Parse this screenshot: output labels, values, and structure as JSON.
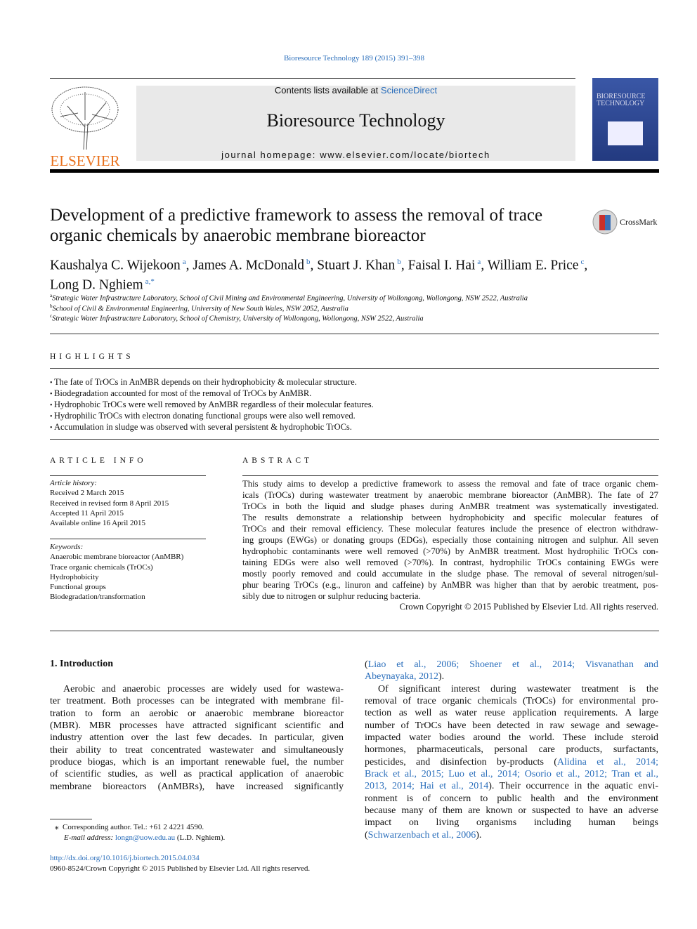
{
  "journal_ref": "Bioresource Technology 189 (2015) 391–398",
  "header": {
    "contents_prefix": "Contents lists available at ",
    "contents_link": "ScienceDirect",
    "journal_title": "Bioresource Technology",
    "homepage": "journal homepage: www.elsevier.com/locate/biortech",
    "publisher_logo": "ELSEVIER",
    "cover_text": "BIORESOURCE TECHNOLOGY"
  },
  "colors": {
    "link": "#2a6ebb",
    "elsevier_orange": "#e9711c"
  },
  "title": "Development of a predictive framework to assess the removal of trace organic chemicals by anaerobic membrane bioreactor",
  "crossmark": "CrossMark",
  "authors": [
    {
      "name": "Kaushalya C. Wijekoon",
      "sup": "a"
    },
    {
      "name": "James A. McDonald",
      "sup": "b"
    },
    {
      "name": "Stuart J. Khan",
      "sup": "b"
    },
    {
      "name": "Faisal I. Hai",
      "sup": "a"
    },
    {
      "name": "William E. Price",
      "sup": "c"
    },
    {
      "name": "Long D. Nghiem",
      "sup": "a,*"
    }
  ],
  "affiliations": [
    {
      "sup": "a",
      "text": "Strategic Water Infrastructure Laboratory, School of Civil Mining and Environmental Engineering, University of Wollongong, Wollongong, NSW 2522, Australia"
    },
    {
      "sup": "b",
      "text": "School of Civil & Environmental Engineering, University of New South Wales, NSW 2052, Australia"
    },
    {
      "sup": "c",
      "text": "Strategic Water Infrastructure Laboratory, School of Chemistry, University of Wollongong, Wollongong, NSW 2522, Australia"
    }
  ],
  "highlights": {
    "heading": "HIGHLIGHTS",
    "items": [
      "The fate of TrOCs in AnMBR depends on their hydrophobicity & molecular structure.",
      "Biodegradation accounted for most of the removal of TrOCs by AnMBR.",
      "Hydrophobic TrOCs were well removed by AnMBR regardless of their molecular features.",
      "Hydrophilic TrOCs with electron donating functional groups were also well removed.",
      "Accumulation in sludge was observed with several persistent & hydrophobic TrOCs."
    ]
  },
  "article_info": {
    "heading": "ARTICLE INFO",
    "history_label": "Article history:",
    "history": [
      "Received 2 March 2015",
      "Received in revised form 8 April 2015",
      "Accepted 11 April 2015",
      "Available online 16 April 2015"
    ],
    "keywords_label": "Keywords:",
    "keywords": [
      "Anaerobic membrane bioreactor (AnMBR)",
      "Trace organic chemicals (TrOCs)",
      "Hydrophobicity",
      "Functional groups",
      "Biodegradation/transformation"
    ]
  },
  "abstract": {
    "heading": "ABSTRACT",
    "lines": [
      "This study aims to develop a predictive framework to assess the removal and fate of trace organic chem-",
      "icals (TrOCs) during wastewater treatment by anaerobic membrane bioreactor (AnMBR). The fate of 27",
      "TrOCs in both the liquid and sludge phases during AnMBR treatment was systematically investigated.",
      "The results demonstrate a relationship between hydrophobicity and specific molecular features of",
      "TrOCs and their removal efficiency. These molecular features include the presence of electron withdraw-",
      "ing groups (EWGs) or donating groups (EDGs), especially those containing nitrogen and sulphur. All seven",
      "hydrophobic contaminants were well removed (>70%) by AnMBR treatment. Most hydrophilic TrOCs con-",
      "taining EDGs were also well removed (>70%). In contrast, hydrophilic TrOCs containing EWGs were",
      "mostly poorly removed and could accumulate in the sludge phase. The removal of several nitrogen/sul-",
      "phur bearing TrOCs (e.g., linuron and caffeine) by AnMBR was higher than that by aerobic treatment, pos-",
      "sibly due to nitrogen or sulphur reducing bacteria."
    ],
    "copyright": "Crown Copyright © 2015 Published by Elsevier Ltd. All rights reserved."
  },
  "intro": {
    "heading": "1. Introduction",
    "left_lines": [
      "Aerobic and anaerobic processes are widely used for wastewa-",
      "ter treatment. Both processes can be integrated with membrane fil-",
      "tration to form an aerobic or anaerobic membrane bioreactor",
      "(MBR). MBR processes have attracted significant scientific and",
      "industry attention over the last few decades. In particular, given",
      "their ability to treat concentrated wastewater and simultaneously",
      "produce biogas, which is an important renewable fuel, the number",
      "of scientific studies, as well as practical application of anaerobic",
      "membrane bioreactors (AnMBRs), have increased significantly"
    ],
    "right_lines": [
      [
        [
          "(",
          0
        ],
        [
          "Liao et al., 2006; Shoener et al., 2014; Visvanathan and",
          1
        ]
      ],
      [
        [
          "Abeynayaka, 2012",
          1
        ],
        [
          ").",
          0
        ]
      ],
      [
        [
          "Of significant interest during wastewater treatment is the",
          0
        ]
      ],
      [
        [
          "removal of trace organic chemicals (TrOCs) for environmental pro-",
          0
        ]
      ],
      [
        [
          "tection as well as water reuse application requirements. A large",
          0
        ]
      ],
      [
        [
          "number of TrOCs have been detected in raw sewage and sewage-",
          0
        ]
      ],
      [
        [
          "impacted water bodies around the world. These include steroid",
          0
        ]
      ],
      [
        [
          "hormones, pharmaceuticals, personal care products, surfactants,",
          0
        ]
      ],
      [
        [
          "pesticides, and disinfection by-products (",
          0
        ],
        [
          "Alidina et al., 2014;",
          1
        ]
      ],
      [
        [
          "Brack et al., 2015; Luo et al., 2014; Osorio et al., 2012; Tran et al.,",
          1
        ]
      ],
      [
        [
          "2013, 2014; Hai et al., 2014",
          1
        ],
        [
          "). Their occurrence in the aquatic envi-",
          0
        ]
      ],
      [
        [
          "ronment is of concern to public health and the environment",
          0
        ]
      ],
      [
        [
          "because many of them are known or suspected to have an adverse",
          0
        ]
      ],
      [
        [
          "impact on living organisms including human beings",
          0
        ]
      ],
      [
        [
          "(",
          0
        ],
        [
          "Schwarzenbach et al., 2006",
          1
        ],
        [
          ").",
          0
        ]
      ]
    ]
  },
  "footnote": {
    "star": "⁎",
    "corresponding": "Corresponding author. Tel.: +61 2 4221 4590.",
    "email_label": "E-mail address: ",
    "email": "longn@uow.edu.au",
    "email_suffix": " (L.D. Nghiem)."
  },
  "doi": "http://dx.doi.org/10.1016/j.biortech.2015.04.034",
  "issn": "0960-8524/Crown Copyright © 2015 Published by Elsevier Ltd. All rights reserved."
}
